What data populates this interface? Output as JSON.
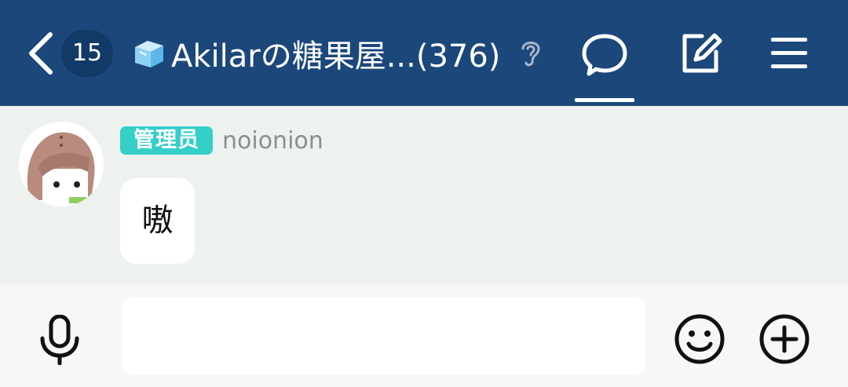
{
  "header": {
    "unread_count": "15",
    "group_title": "Akilarの糖果屋...(376)",
    "icons": [
      "back-arrow-icon",
      "ice-cube-icon",
      "ear-icon",
      "chat-bubble-icon",
      "compose-icon",
      "menu-icon"
    ]
  },
  "message": {
    "role_badge": "管理员",
    "nickname": "noionion",
    "text": "嗷"
  },
  "composer": {
    "placeholder": "",
    "icons": [
      "microphone-icon",
      "emoji-icon",
      "plus-icon"
    ]
  },
  "colors": {
    "header_bg": "#1b477b",
    "badge_bg": "#123a66",
    "role_bg": "#34cfc7",
    "chat_bg": "#eef2ef"
  }
}
